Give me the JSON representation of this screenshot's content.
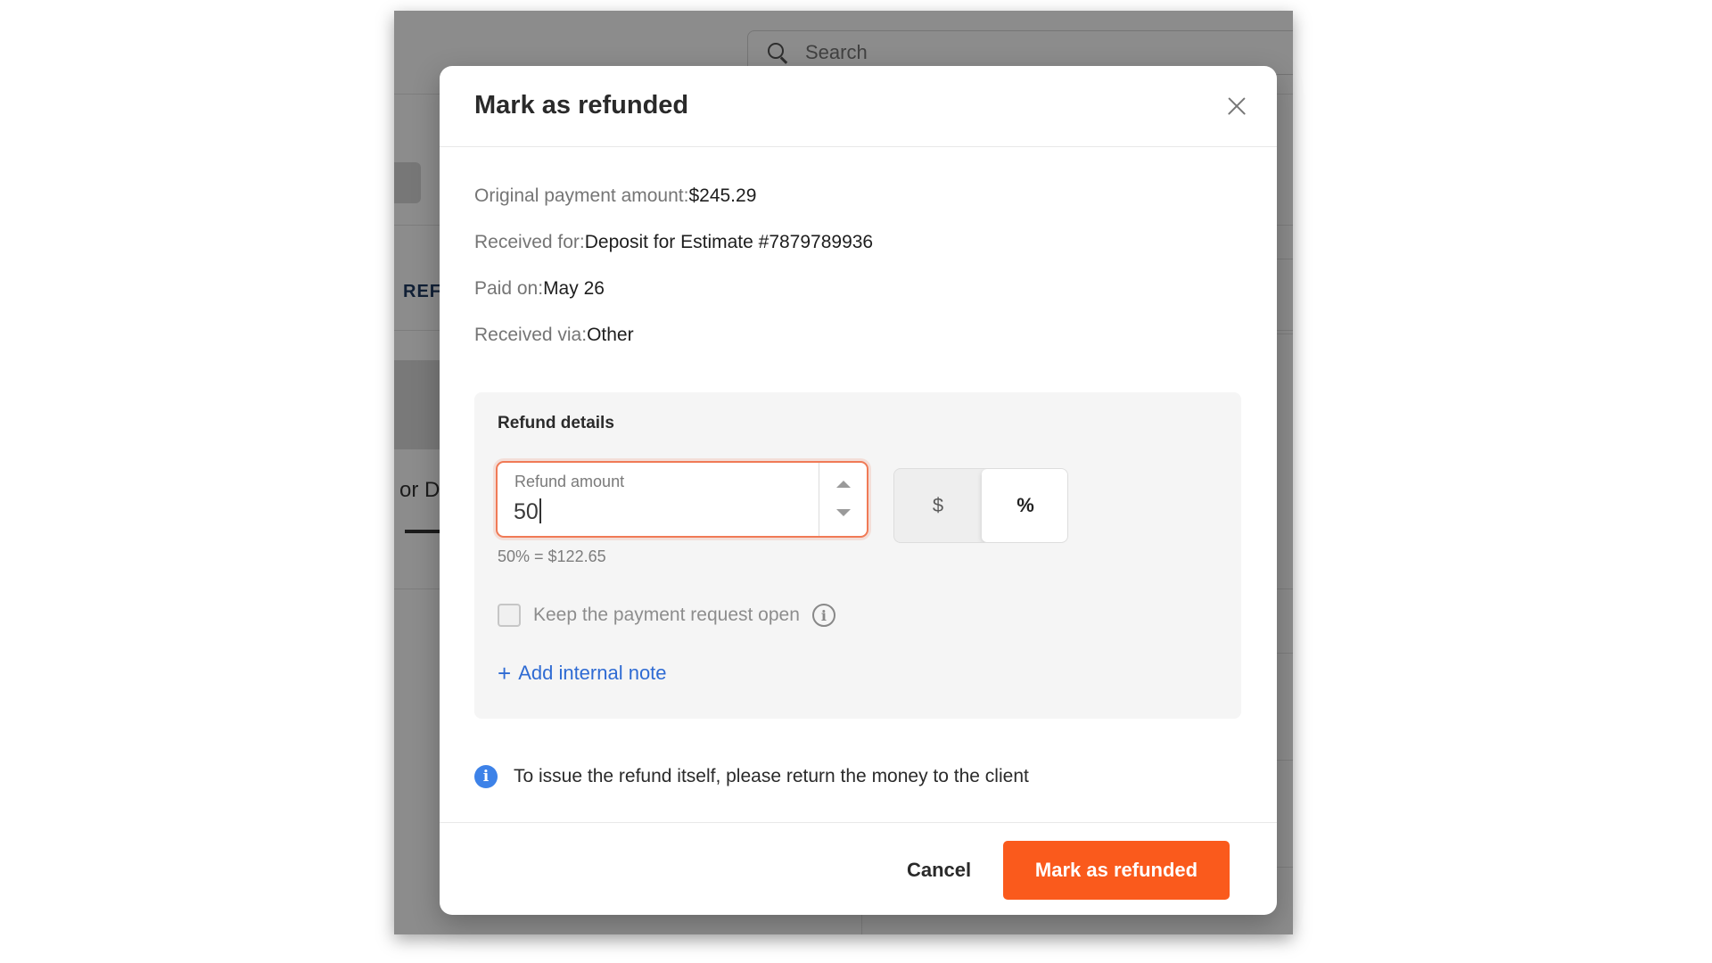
{
  "background": {
    "search_placeholder": "Search",
    "tab_fragment": "REFU",
    "text_fragment": "or D"
  },
  "modal": {
    "title": "Mark as refunded",
    "close_icon": "close-icon",
    "details": [
      {
        "label": "Original payment amount:",
        "value": "$245.29"
      },
      {
        "label": "Received for:",
        "value": "Deposit for Estimate #7879789936"
      },
      {
        "label": "Paid on:",
        "value": "May 26"
      },
      {
        "label": "Received via:",
        "value": "Other"
      }
    ],
    "refund": {
      "heading": "Refund details",
      "amount_label": "Refund amount",
      "amount_value": "50",
      "unit_dollar": "$",
      "unit_percent": "%",
      "selected_unit": "%",
      "calculation": "50% = $122.65",
      "keep_open_label": "Keep the payment request open",
      "keep_open_checked": false,
      "add_note_label": "Add internal note",
      "add_note_icon": "+"
    },
    "notice": "To issue the refund itself, please return the money to the client",
    "cancel_label": "Cancel",
    "submit_label": "Mark as refunded"
  },
  "colors": {
    "accent": "#fa5a1c",
    "link": "#2f6bd3",
    "focus_border": "#f07a56",
    "info_blue": "#3d82e8"
  }
}
